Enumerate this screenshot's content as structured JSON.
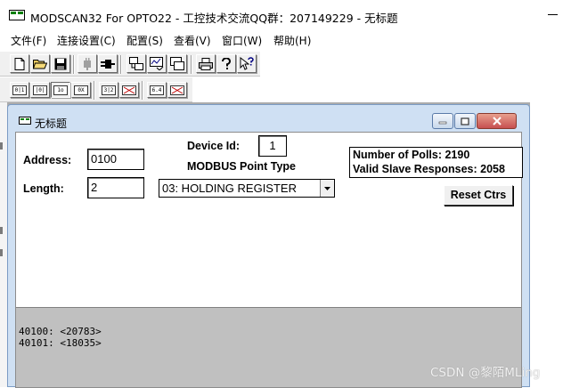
{
  "window": {
    "title": "MODSCAN32 For OPTO22 - 工控技术交流QQ群：207149229 - 无标题"
  },
  "menu": {
    "items": [
      "文件(F)",
      "连接设置(C)",
      "配置(S)",
      "查看(V)",
      "窗口(W)",
      "帮助(H)"
    ]
  },
  "toolbar2": {
    "labels": [
      "0|1",
      "|0|",
      "1o",
      "0X",
      "3|2",
      "",
      "6.4",
      ""
    ]
  },
  "child": {
    "title": "无标题",
    "address_label": "Address:",
    "address_value": "0100",
    "length_label": "Length:",
    "length_value": "2",
    "device_id_label": "Device Id:",
    "device_id_value": "1",
    "point_type_label": "MODBUS Point Type",
    "point_type_value": "03: HOLDING REGISTER",
    "polls_text": "Number of Polls: 2190",
    "responses_text": "Valid Slave Responses: 2058",
    "reset_label": "Reset Ctrs",
    "data_lines": [
      "40100: <20783>",
      "40101: <18035>"
    ]
  },
  "watermark": "CSDN @黎陌MLing"
}
